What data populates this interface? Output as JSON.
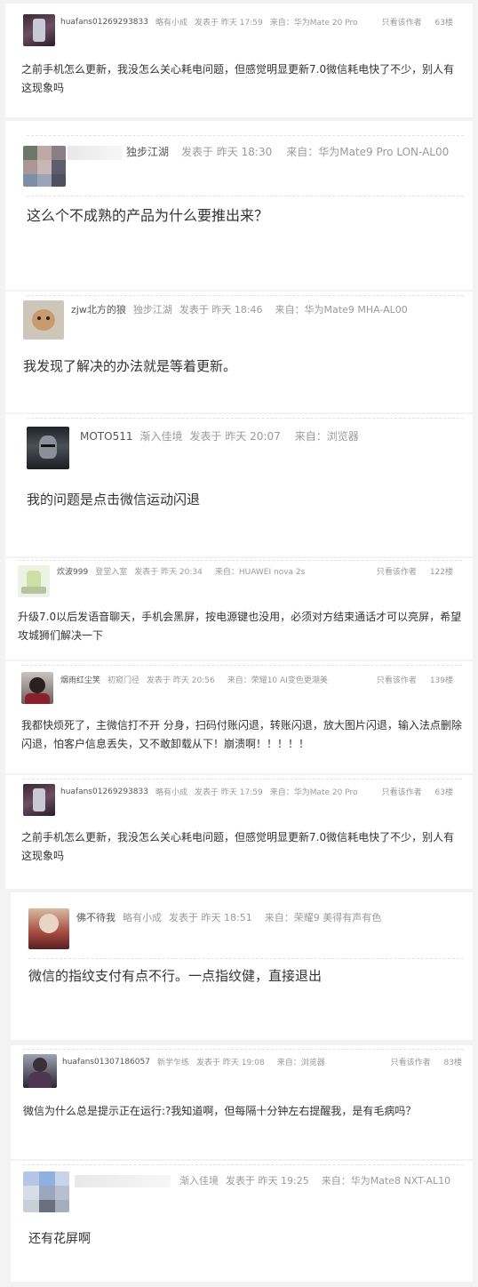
{
  "posts": [
    {
      "user": "huafans01269293833",
      "level": "略有小成",
      "posted": "发表于  昨天 17:59",
      "device": "来自：华为Mate 20 Pro",
      "only_author": "只看该作者",
      "floor": "63楼",
      "body": "之前手机怎么更新，我没怎么关心耗电问题，但感觉明显更新7.0微信耗电快了不少，别人有这现象吗"
    },
    {
      "user": "独步江湖",
      "level": "",
      "posted": "发表于  昨天 18:30",
      "device": "来自：华为Mate9 Pro LON-AL00",
      "body": "这么个不成熟的产品为什么要推出来？"
    },
    {
      "user": "zjw北方的狼",
      "level": "独步江湖",
      "posted": "发表于  昨天 18:46",
      "device": "来自：华为Mate9 MHA-AL00",
      "body": "我发现了解决的办法就是等着更新。"
    },
    {
      "user": "MOTO511",
      "level": "渐入佳境",
      "posted": "发表于  昨天 20:07",
      "device": "来自：浏览器",
      "body": "我的问题是点击微信运动闪退"
    },
    {
      "user": "炊波999",
      "level": "登堂入室",
      "posted": "发表于  昨天 20:34",
      "device": "来自：HUAWEI nova 2s",
      "only_author": "只看该作者",
      "floor": "122楼",
      "body": "升级7.0以后发语音聊天，手机会黑屏，按电源键也没用，必须对方结束通话才可以亮屏，希望攻城狮们解决一下"
    },
    {
      "user": "烟雨红尘笑",
      "level": "初窥门径",
      "posted": "发表于  昨天 20:56",
      "device": "来自：荣耀10 AI变色更潮美",
      "only_author": "只看该作者",
      "floor": "139楼",
      "body": "我都快烦死了，主微信打不开 分身，扫码付账闪退，转账闪退，放大图片闪退，输入法点删除闪退，怕客户信息丢失，又不敢卸载从下！崩溃啊！！！！！"
    },
    {
      "user": "huafans01269293833",
      "level": "略有小成",
      "posted": "发表于  昨天 17:59",
      "device": "来自：华为Mate 20 Pro",
      "only_author": "只看该作者",
      "floor": "63楼",
      "body": "之前手机怎么更新，我没怎么关心耗电问题，但感觉明显更新7.0微信耗电快了不少，别人有这现象吗"
    },
    {
      "user": "佛不待我",
      "level": "略有小成",
      "posted": "发表于  昨天 18:51",
      "device": "来自：荣耀9 美得有声有色",
      "body": "微信的指纹支付有点不行。一点指纹健，直接退出"
    },
    {
      "user": "huafans01307186057",
      "level": "新学乍练",
      "posted": "发表于  昨天 19:08",
      "device": "来自：浏览器",
      "only_author": "只看该作者",
      "floor": "83楼",
      "body": "微信为什么总是提示正在运行:?我知道啊，但每隔十分钟左右提醒我，是有毛病吗？"
    },
    {
      "user": "",
      "level": "渐入佳境",
      "posted": "发表于  昨天 19:25",
      "device": "来自：华为Mate8 NXT-AL10",
      "body": "还有花屏啊"
    }
  ],
  "colors": {
    "meta": "#9a9a9a",
    "text": "#333333",
    "bg": "#f3f3f3"
  }
}
